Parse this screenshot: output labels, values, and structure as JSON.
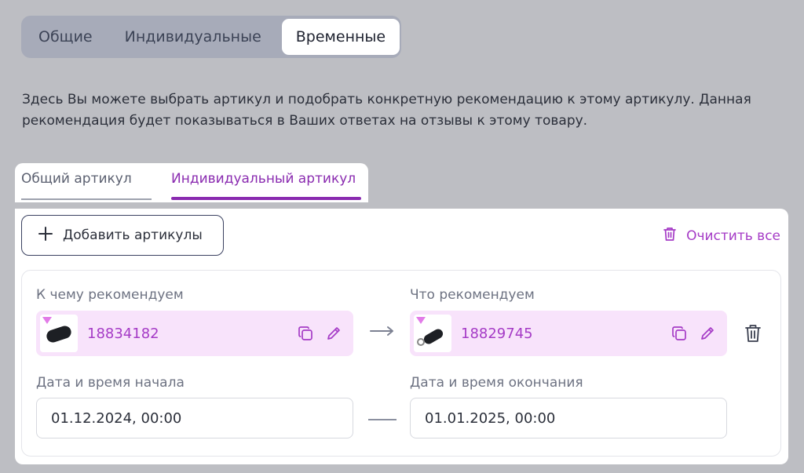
{
  "tabs": {
    "general": "Общие",
    "individual": "Индивидуальные",
    "temporary": "Временные"
  },
  "description": "Здесь Вы можете выбрать артикул и подобрать конкретную рекомендацию к этому артикулу. Данная рекомендация будет показываться в Ваших ответах на отзывы к этому товару.",
  "subtabs": {
    "general": "Общий артикул",
    "individual": "Индивидуальный артикул"
  },
  "toolbar": {
    "add_label": "Добавить артикулы",
    "clear_label": "Очистить все"
  },
  "rule": {
    "source_label": "К чему рекомендуем",
    "source_article": "18834182",
    "target_label": "Что рекомендуем",
    "target_article": "18829745",
    "start_label": "Дата и время начала",
    "start_value": "01.12.2024, 00:00",
    "end_label": "Дата и время окончания",
    "end_value": "01.01.2025, 00:00"
  },
  "colors": {
    "accent": "#a53bc6",
    "product_bg": "#f8e3fb"
  }
}
